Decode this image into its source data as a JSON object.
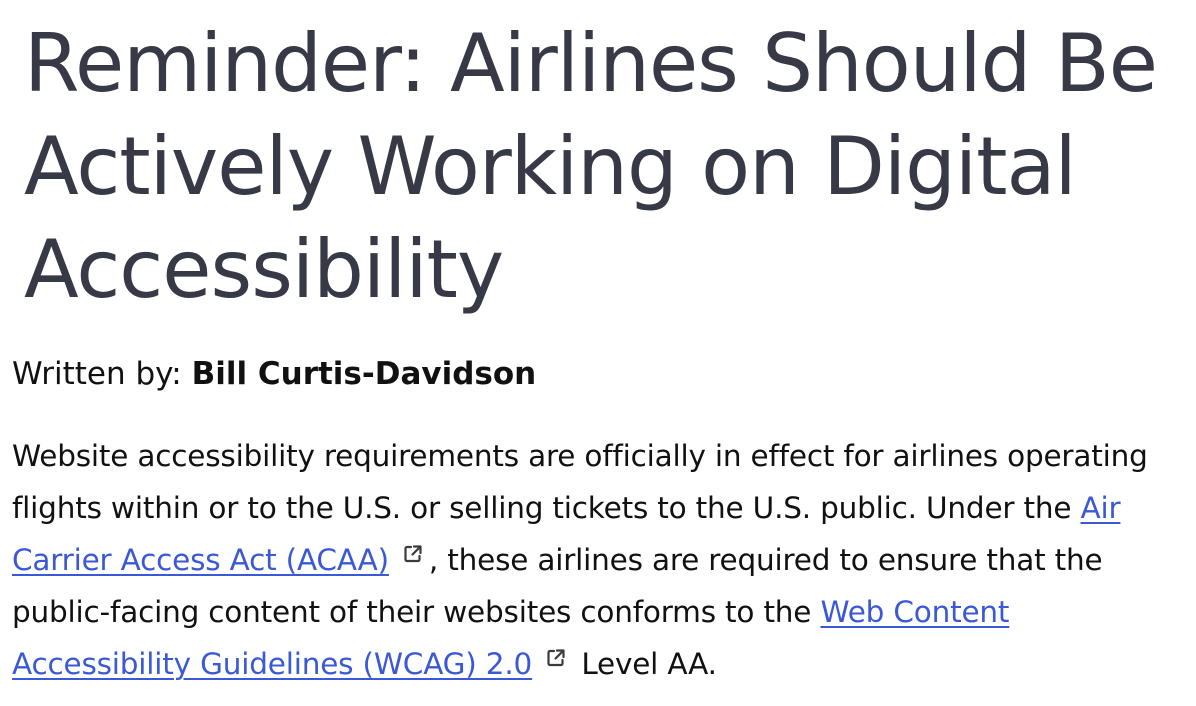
{
  "article": {
    "title": "Reminder: Airlines Should Be Actively Working on Digital Accessibility",
    "byline": {
      "prefix": "Written by:",
      "author": "Bill Curtis-Davidson"
    },
    "paragraph": {
      "text_1": "Website accessibility requirements are officially in effect for airlines operating flights within or to the U.S. or selling tickets to the U.S. public. Under the",
      "link_1": "Air Carrier Access Act (ACAA)",
      "text_2": ", these airlines are required to ensure that the public-facing content of their websites conforms to the",
      "link_2": "Web Content Accessibility Guidelines (WCAG) 2.0",
      "text_3": "Level AA."
    }
  },
  "colors": {
    "title": "#373a46",
    "text": "#111111",
    "link": "#3b59d6"
  },
  "icons": {
    "external_link": "external-link-icon"
  }
}
